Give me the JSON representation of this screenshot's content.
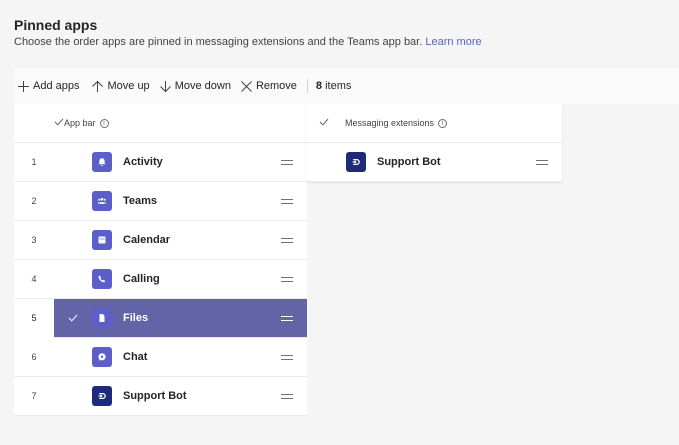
{
  "header": {
    "title": "Pinned apps",
    "subtitle": "Choose the order apps are pinned in messaging extensions and the Teams app bar.",
    "learn_more": "Learn more"
  },
  "toolbar": {
    "add_label": "Add apps",
    "move_up_label": "Move up",
    "move_down_label": "Move down",
    "remove_label": "Remove",
    "count_value": "8",
    "count_suffix": "items"
  },
  "app_bar": {
    "header_label": "App bar",
    "rows": [
      {
        "num": "1",
        "label": "Activity",
        "icon": "bell-icon",
        "color": "#5b5fc7",
        "selected": false
      },
      {
        "num": "2",
        "label": "Teams",
        "icon": "people-icon",
        "color": "#5b5fc7",
        "selected": false
      },
      {
        "num": "3",
        "label": "Calendar",
        "icon": "calendar-icon",
        "color": "#5b5fc7",
        "selected": false
      },
      {
        "num": "4",
        "label": "Calling",
        "icon": "phone-icon",
        "color": "#5b5fc7",
        "selected": false
      },
      {
        "num": "5",
        "label": "Files",
        "icon": "file-icon",
        "color": "#5b5fc7",
        "selected": true
      },
      {
        "num": "6",
        "label": "Chat",
        "icon": "chat-icon",
        "color": "#5b5fc7",
        "selected": false
      },
      {
        "num": "7",
        "label": "Support Bot",
        "icon": "bot-icon",
        "color": "#1f2a7a",
        "selected": false
      }
    ]
  },
  "messaging_extensions": {
    "header_label": "Messaging extensions",
    "rows": [
      {
        "label": "Support Bot",
        "icon": "bot-icon",
        "color": "#1f2a7a"
      }
    ]
  },
  "colors": {
    "accent": "#6264a7",
    "brand_icon": "#5b5fc7",
    "link": "#5b5fc7"
  }
}
